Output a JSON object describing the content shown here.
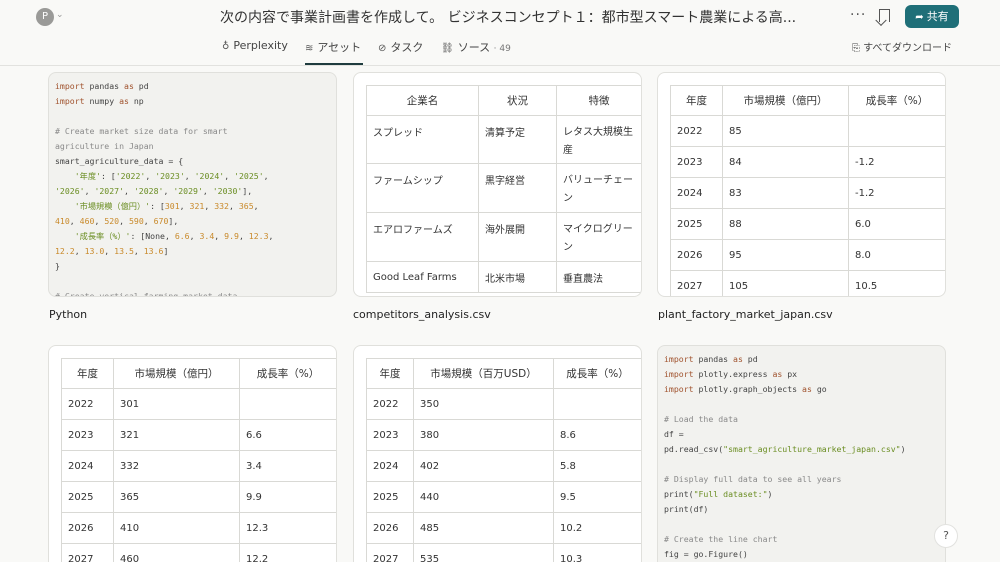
{
  "header": {
    "avatar_letter": "P",
    "title": "次の内容で事業計画書を作成して。 ビジネスコンセプト１：都市型スマート農業による高...",
    "more_label": "···",
    "share_label": "共有"
  },
  "tabs": {
    "perplexity": "Perplexity",
    "assets": "アセット",
    "tasks": "タスク",
    "sources": "ソース",
    "sources_count": "· 49",
    "download_all": "すべてダウンロード"
  },
  "cards": {
    "python1_label": "Python",
    "competitors_label": "competitors_analysis.csv",
    "plant_label": "plant_factory_market_japan.csv"
  },
  "competitors": {
    "headers": [
      "企業名",
      "状況",
      "特徴"
    ],
    "rows": [
      [
        "スプレッド",
        "清算予定",
        "レタス大規模生産"
      ],
      [
        "ファームシップ",
        "黒字経営",
        "バリューチェーン"
      ],
      [
        "エアロファームズ",
        "海外展開",
        "マイクログリーン"
      ],
      [
        "Good Leaf Farms",
        "北米市場",
        "垂直農法"
      ]
    ]
  },
  "plant_factory": {
    "headers": [
      "年度",
      "市場規模（億円）",
      "成長率（%）"
    ],
    "rows": [
      [
        "2022",
        "85",
        ""
      ],
      [
        "2023",
        "84",
        "-1.2"
      ],
      [
        "2024",
        "83",
        "-1.2"
      ],
      [
        "2025",
        "88",
        "6.0"
      ],
      [
        "2026",
        "95",
        "8.0"
      ],
      [
        "2027",
        "105",
        "10.5"
      ]
    ]
  },
  "smart_agri": {
    "headers": [
      "年度",
      "市場規模（億円）",
      "成長率（%）"
    ],
    "rows": [
      [
        "2022",
        "301",
        ""
      ],
      [
        "2023",
        "321",
        "6.6"
      ],
      [
        "2024",
        "332",
        "3.4"
      ],
      [
        "2025",
        "365",
        "9.9"
      ],
      [
        "2026",
        "410",
        "12.3"
      ],
      [
        "2027",
        "460",
        "12.2"
      ]
    ]
  },
  "usd_market": {
    "headers": [
      "年度",
      "市場規模（百万USD）",
      "成長率（%）"
    ],
    "rows": [
      [
        "2022",
        "350",
        ""
      ],
      [
        "2023",
        "380",
        "8.6"
      ],
      [
        "2024",
        "402",
        "5.8"
      ],
      [
        "2025",
        "440",
        "9.5"
      ],
      [
        "2026",
        "485",
        "10.2"
      ],
      [
        "2027",
        "535",
        "10.3"
      ]
    ]
  },
  "help_label": "?"
}
